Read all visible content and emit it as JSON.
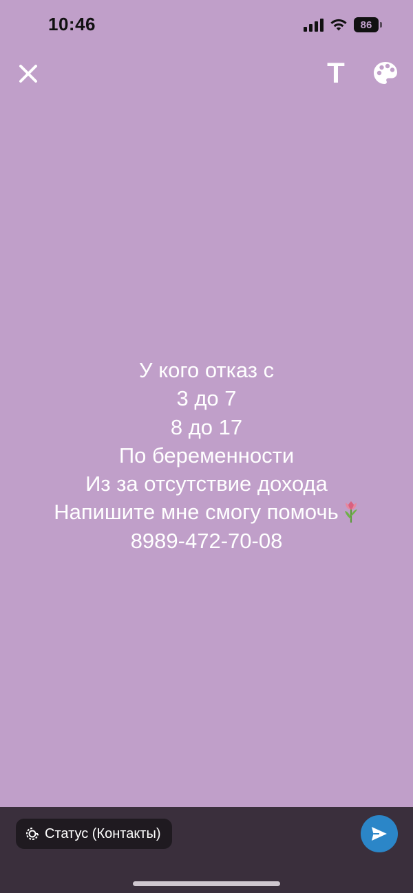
{
  "colors": {
    "background": "#c09fc9",
    "bottom_bar": "#3a2f3c",
    "pill": "#1f1a20",
    "send_button": "#2b86c8",
    "text": "#ffffff"
  },
  "status_bar": {
    "time": "10:46",
    "battery": "86",
    "icons": [
      "cellular-signal-icon",
      "wifi-icon",
      "battery-icon"
    ]
  },
  "toolbar": {
    "close_icon": "close-icon",
    "text_tool_label": "T",
    "palette_icon": "palette-icon"
  },
  "status_text": {
    "lines": [
      "У кого отказ с",
      "3 до 7",
      "8 до 17",
      "По беременности",
      "Из за отсутствие дохода",
      "Напишите мне смогу помочь",
      "8989-472-70-08"
    ],
    "emoji_icon": "tulip-icon"
  },
  "bottom_bar": {
    "privacy_label": "Статус (Контакты)",
    "privacy_icon": "status-privacy-icon",
    "send_icon": "send-icon"
  }
}
